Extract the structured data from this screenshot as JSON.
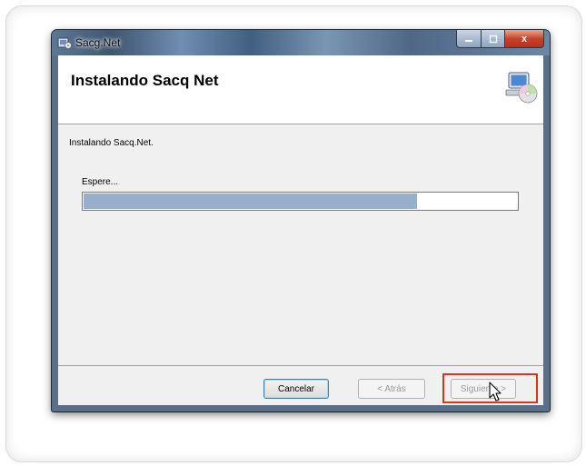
{
  "window": {
    "title": "Sacg.Net",
    "close_glyph": "x"
  },
  "header": {
    "title": "Instalando Sacq Net",
    "icon": "computer-disc-icon"
  },
  "body": {
    "status_text": "Instalando Sacq.Net.",
    "wait_label": "Espere...",
    "progress_fraction": 0.77
  },
  "buttons": {
    "cancel_label": "Cancelar",
    "back_label": "< Atrás",
    "next_label": "Siguiente >"
  },
  "colors": {
    "progress_fill": "#97afcb",
    "highlight": "#d9351c"
  }
}
